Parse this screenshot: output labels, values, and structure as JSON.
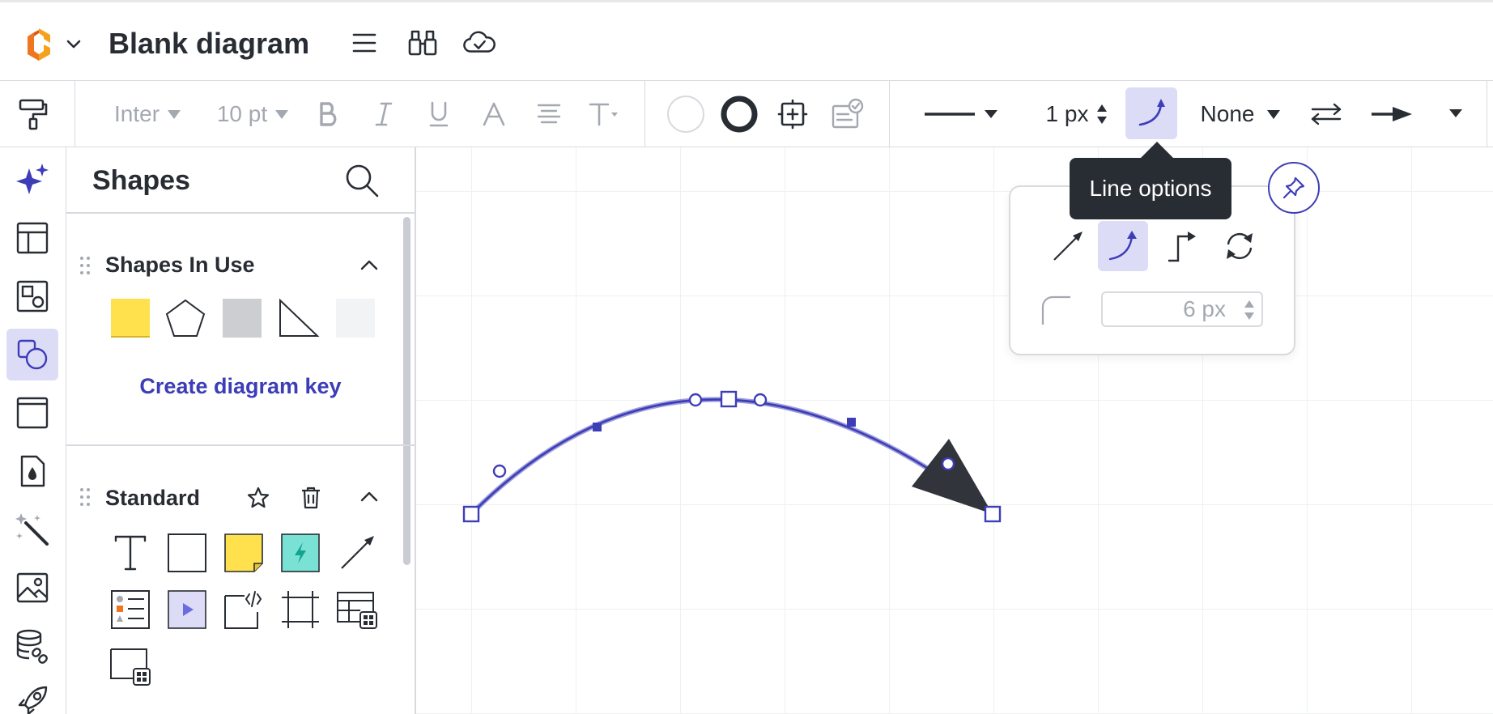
{
  "header": {
    "title": "Blank diagram",
    "icons": [
      "logo-icon",
      "chevron-down-icon",
      "menu-icon",
      "binoculars-icon",
      "cloud-saved-icon"
    ]
  },
  "toolbar": {
    "font_family": "Inter",
    "font_size": "10 pt",
    "line_width": "1 px",
    "line_end": "None",
    "icons": [
      "paint-roller-icon",
      "bold-icon",
      "italic-icon",
      "underline-icon",
      "text-color-icon",
      "align-icon",
      "text-options-icon",
      "fill-color-icon",
      "border-color-icon",
      "crop-icon",
      "conditional-format-icon",
      "line-style-icon",
      "curved-line-icon",
      "swap-arrows-icon",
      "arrow-end-icon"
    ]
  },
  "rail": {
    "icons": [
      "sparkle-icon",
      "template-icon",
      "shapes-library-icon",
      "shapes-icon",
      "frame-icon",
      "ink-drop-icon",
      "magic-wand-icon",
      "image-icon",
      "database-link-icon",
      "rocket-icon"
    ],
    "selected": "shapes-icon"
  },
  "panel": {
    "title": "Shapes",
    "sections": [
      {
        "title": "Shapes In Use",
        "shapes": [
          "sticky-note-shape",
          "pentagon-shape",
          "gray-rectangle-shape",
          "right-triangle-shape",
          "light-rectangle-shape"
        ],
        "link": "Create diagram key"
      },
      {
        "title": "Standard",
        "shapes": [
          "text-shape",
          "rectangle-shape",
          "sticky-note-shape",
          "action-shape",
          "arrow-line-shape",
          "list-shape",
          "video-shape",
          "embed-shape",
          "frame-shape",
          "table-shape",
          "card-shape"
        ]
      }
    ]
  },
  "tooltip": {
    "text": "Line options"
  },
  "line_options": {
    "styles": [
      "straight-line-icon",
      "curved-line-icon",
      "elbow-line-icon",
      "rotate-line-icon"
    ],
    "selected": "curved-line-icon",
    "corner_radius": "6 px"
  },
  "colors": {
    "accent": "#3d3db8",
    "accent_bg": "#dcdcf7",
    "text": "#282c33",
    "muted": "#a4a8b0",
    "tooltip_bg": "#282c33",
    "sticky_yellow": "#ffe14d",
    "action_teal": "#79e2d5"
  }
}
